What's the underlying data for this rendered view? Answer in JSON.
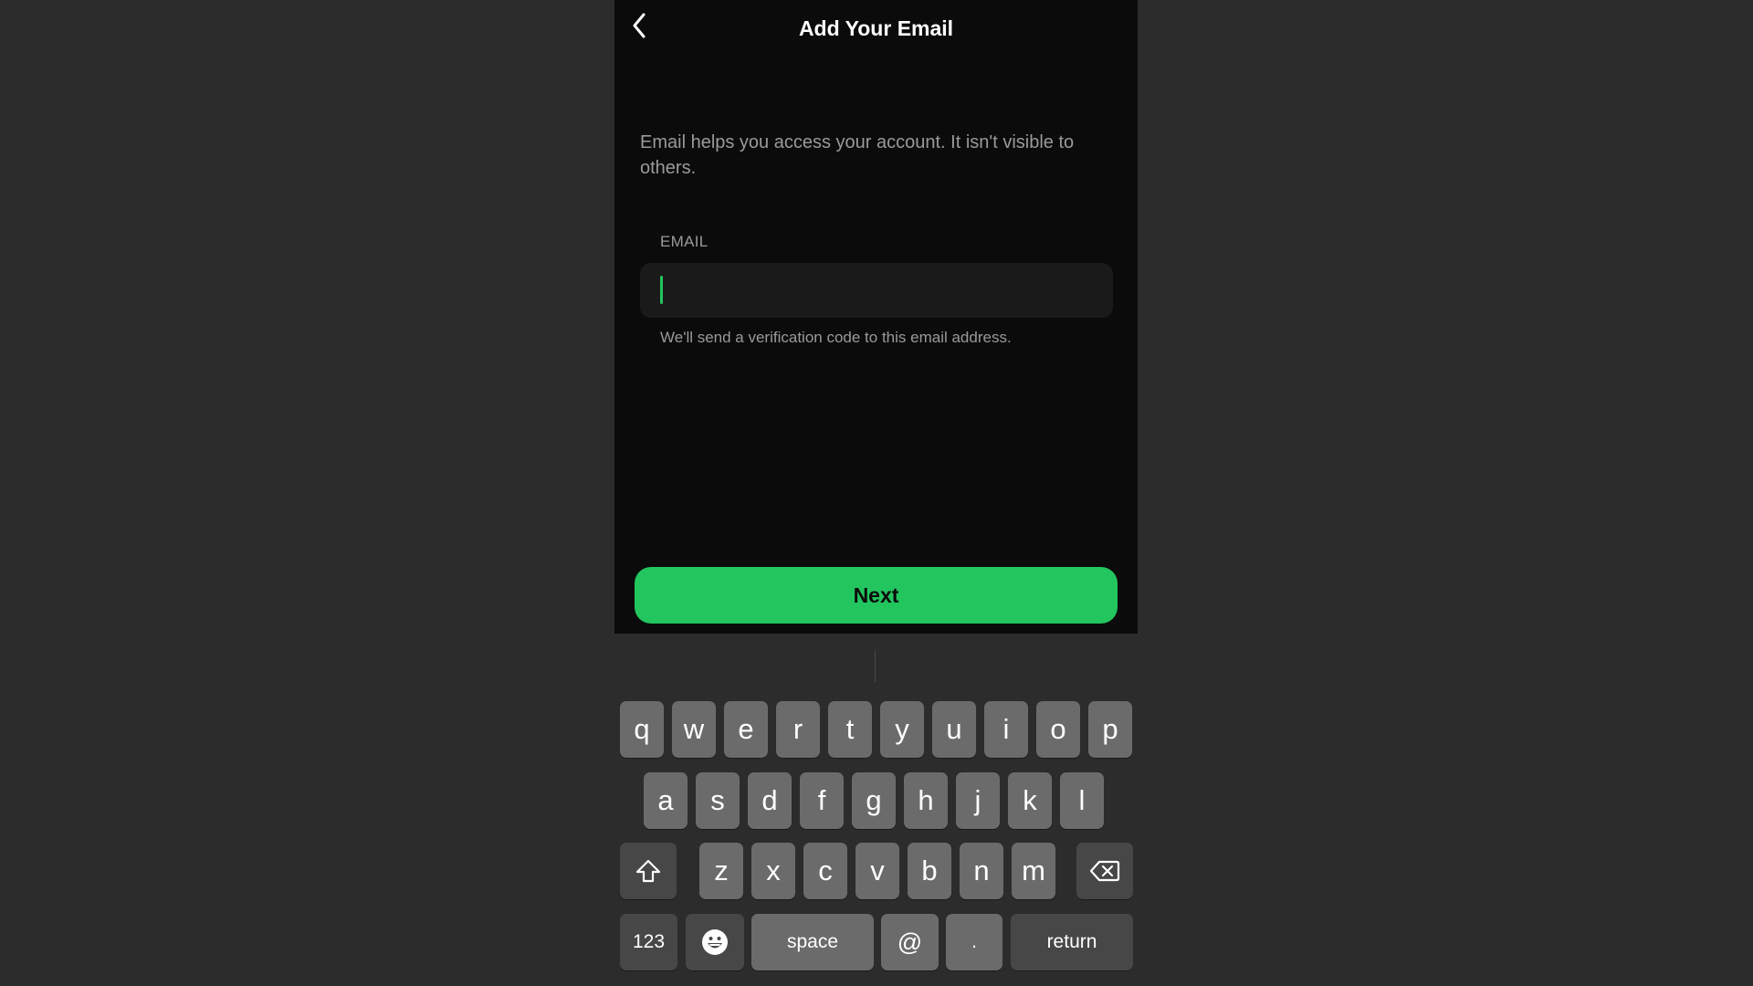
{
  "colors": {
    "accent": "#22c55e",
    "background": "#2c2c2c",
    "screen": "#0b0b0b"
  },
  "header": {
    "back_icon": "chevron-left-icon",
    "title": "Add Your Email"
  },
  "main": {
    "description": "Email helps you access your account. It isn't visible to others.",
    "email_field": {
      "label": "EMAIL",
      "value": "",
      "helper": "We'll send a verification code to this email address."
    },
    "next_button": "Next"
  },
  "keyboard": {
    "row1": [
      "q",
      "w",
      "e",
      "r",
      "t",
      "y",
      "u",
      "i",
      "o",
      "p"
    ],
    "row2": [
      "a",
      "s",
      "d",
      "f",
      "g",
      "h",
      "j",
      "k",
      "l"
    ],
    "row3": [
      "z",
      "x",
      "c",
      "v",
      "b",
      "n",
      "m"
    ],
    "shift_icon": "shift-icon",
    "delete_icon": "delete-icon",
    "numbers_label": "123",
    "emoji_icon": "emoji-icon",
    "space_label": "space",
    "at_label": "@",
    "dot_label": ".",
    "return_label": "return"
  }
}
